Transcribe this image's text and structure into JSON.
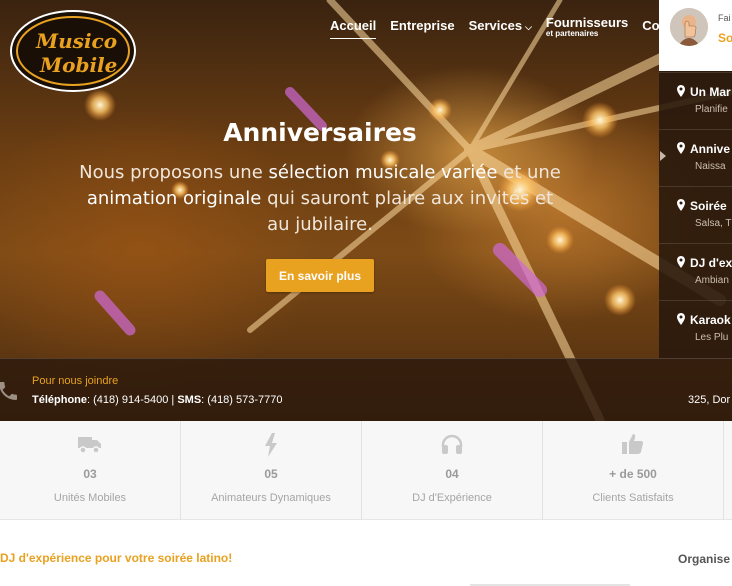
{
  "logo": {
    "line1": "Musico",
    "line2": "Mobile"
  },
  "nav": {
    "items": [
      {
        "label": "Accueil",
        "active": true
      },
      {
        "label": "Entreprise"
      },
      {
        "label": "Services",
        "has_dropdown": true
      },
      {
        "label": "Fournisseurs",
        "sublabel": "et partenaires"
      },
      {
        "label": "Contact"
      }
    ]
  },
  "hero": {
    "title": "Anniversaires",
    "text_parts": [
      "Nous proposons une ",
      "sélection musicale variée",
      " et une ",
      "animation originale",
      " qui sauront plaire aux invités et au jubilaire."
    ],
    "button_label": "En savoir plus"
  },
  "side_panel": {
    "top_line1": "Fai",
    "top_line2": "So",
    "items": [
      {
        "title": "Un Mar",
        "subtitle": "Planifie"
      },
      {
        "title": "Annive",
        "subtitle": "Naissa",
        "active": true
      },
      {
        "title": "Soirée",
        "subtitle": "Salsa, T"
      },
      {
        "title": "DJ d'ex",
        "subtitle": "Ambian"
      },
      {
        "title": "Karaok",
        "subtitle": "Les Plu"
      }
    ]
  },
  "contact": {
    "heading": "Pour nous joindre",
    "phone_label": "Téléphone",
    "phone": ": (418) 914-5400 | ",
    "sms_label": "SMS",
    "sms": ": (418) 573-7770",
    "address": "325, Dor"
  },
  "stats": [
    {
      "icon": "truck-icon",
      "value": "03",
      "label": "Unités Mobiles"
    },
    {
      "icon": "bolt-icon",
      "value": "05",
      "label": "Animateurs Dynamiques"
    },
    {
      "icon": "headphones-icon",
      "value": "04",
      "label": "DJ d'Expérience"
    },
    {
      "icon": "thumbs-up-icon",
      "value": "+ de 500",
      "label": "Clients Satisfaits"
    }
  ],
  "bottom": {
    "title": "DJ d'expérience pour votre soirée latino!",
    "right_heading": "Organise"
  },
  "colors": {
    "accent": "#e9a120",
    "dark_panel": "#28180c",
    "stats_bg": "#f7f7f7"
  }
}
